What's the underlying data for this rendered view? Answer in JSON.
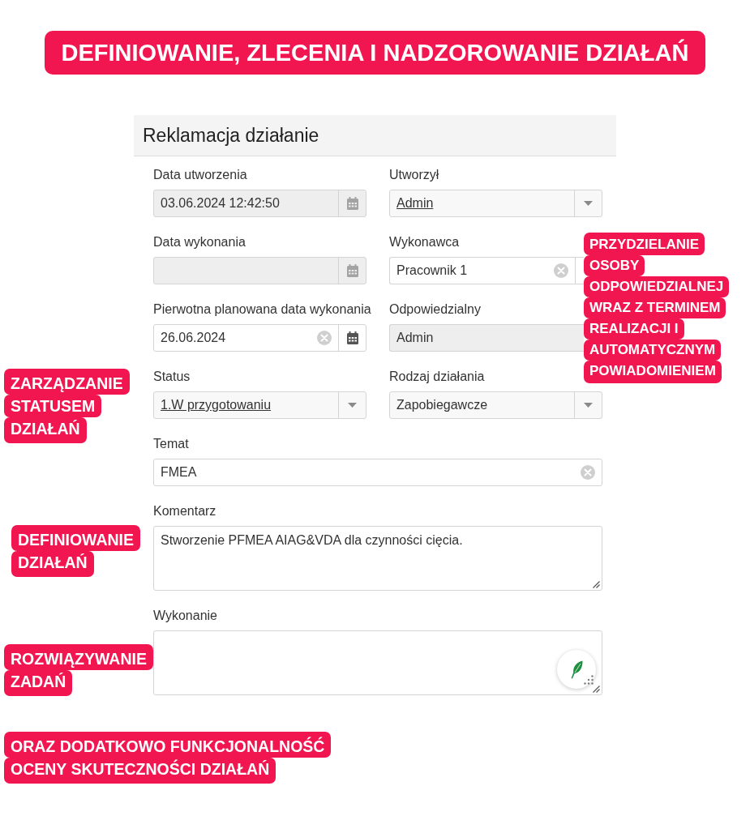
{
  "banner": {
    "title": "DEFINIOWANIE, ZLECENIA I NADZOROWANIE DZIAŁAŃ"
  },
  "form": {
    "title": "Reklamacja działanie",
    "rows": [
      [
        {
          "label": "Data utworzenia",
          "kind": "date",
          "value": "03.06.2024 12:42:50",
          "readonly": true,
          "clearable": false
        },
        {
          "label": "Utworzył",
          "kind": "select",
          "value": "Admin",
          "link": true
        }
      ],
      [
        {
          "label": "Data wykonania",
          "kind": "date",
          "readonly": true,
          "clearable": false
        },
        {
          "label": "Wykonawca",
          "kind": "combo",
          "value": "Pracownik 1",
          "clearable": true
        }
      ],
      [
        {
          "label": "Pierwotna planowana data wykonania",
          "kind": "date",
          "value": "26.06.2024",
          "readonly": false,
          "clearable": true
        },
        {
          "label": "Odpowiedzialny",
          "kind": "text",
          "value": "Admin",
          "readonly": true,
          "clearable": false
        }
      ],
      [
        {
          "label": "Status",
          "kind": "select",
          "value": "1.W przygotowaniu",
          "link": true
        },
        {
          "label": "Rodzaj działania",
          "kind": "select",
          "value": "Zapobiegawcze",
          "link": false
        }
      ],
      [
        {
          "label": "Temat",
          "kind": "text",
          "value": "FMEA",
          "readonly": false,
          "clearable": true
        }
      ],
      [
        {
          "label": "Komentarz",
          "kind": "textarea",
          "value": "Stworzenie PFMEA AIAG&VDA dla czynności cięcia."
        }
      ],
      [
        {
          "label": "Wykonanie",
          "kind": "textarea",
          "writing_assistant": true
        }
      ]
    ]
  },
  "callouts": [
    {
      "lines": [
        "PRZYDZIELANIE",
        "OSOBY",
        "ODPOWIEDZIALNEJ",
        "WRAZ Z TERMINEM",
        "REALIZACJI I",
        "AUTOMATYCZNYM",
        "POWIADOMIENIEM"
      ]
    },
    {
      "lines": [
        "ZARZĄDZANIE",
        "STATUSEM",
        "DZIAŁAŃ"
      ]
    },
    {
      "lines": [
        "DEFINIOWANIE",
        "DZIAŁAŃ"
      ]
    },
    {
      "lines": [
        "ROZWIĄZYWANIE",
        "ZADAŃ"
      ]
    },
    {
      "lines": [
        "ORAZ DODATKOWO FUNKCJONALNOŚĆ",
        "OCENY SKUTECZNOŚCI DZIAŁAŃ"
      ]
    }
  ]
}
